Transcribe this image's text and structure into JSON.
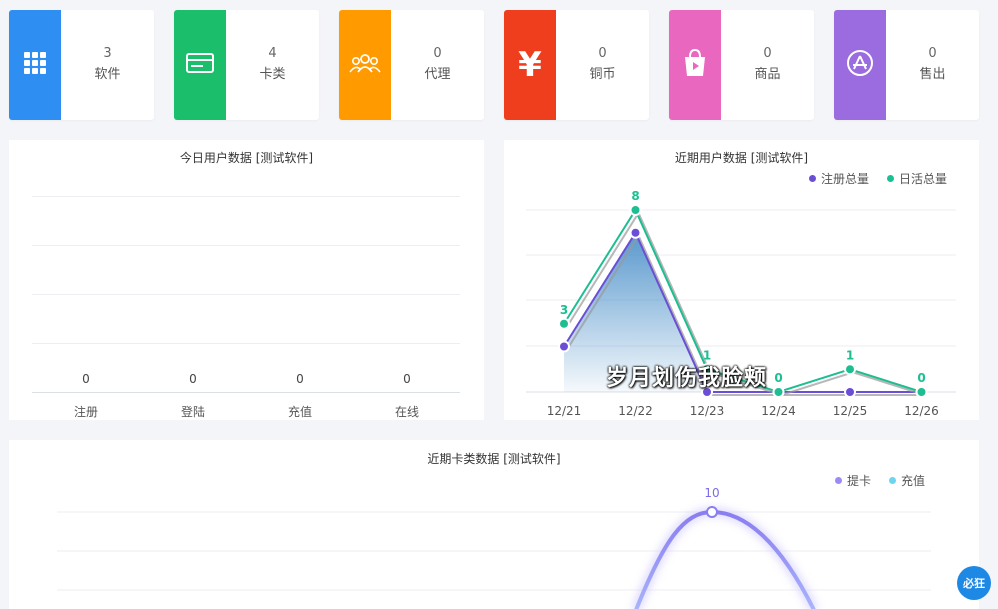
{
  "stats": [
    {
      "value": "3",
      "label": "软件",
      "color": "#2f8ef1",
      "icon": "grid-icon"
    },
    {
      "value": "4",
      "label": "卡类",
      "color": "#1bbf6b",
      "icon": "card-icon"
    },
    {
      "value": "0",
      "label": "代理",
      "color": "#ff9a00",
      "icon": "people-icon"
    },
    {
      "value": "0",
      "label": "铜币",
      "color": "#ee3e1d",
      "icon": "yen-icon"
    },
    {
      "value": "0",
      "label": "商品",
      "color": "#e967be",
      "icon": "shopping-bag-icon"
    },
    {
      "value": "0",
      "label": "售出",
      "color": "#9b6be0",
      "icon": "app-store-icon"
    }
  ],
  "today_chart": {
    "title": "今日用户数据 [测试软件]",
    "chart_data": {
      "type": "bar",
      "categories": [
        "注册",
        "登陆",
        "充值",
        "在线"
      ],
      "values": [
        0,
        0,
        0,
        0
      ],
      "value_labels": [
        "0",
        "0",
        "0",
        "0"
      ]
    }
  },
  "recent_user_chart": {
    "title": "近期用户数据 [测试软件]",
    "legend": [
      {
        "label": "注册总量",
        "color": "#6a4fd6"
      },
      {
        "label": "日活总量",
        "color": "#1dbe91"
      }
    ],
    "chart_data": {
      "type": "line",
      "categories": [
        "12/21",
        "12/22",
        "12/23",
        "12/24",
        "12/25",
        "12/26"
      ],
      "series": [
        {
          "name": "注册总量",
          "values": [
            2,
            7,
            0,
            0,
            0,
            0
          ]
        },
        {
          "name": "日活总量",
          "values": [
            3,
            8,
            1,
            0,
            1,
            0
          ]
        }
      ],
      "point_labels": [
        "3",
        "8",
        "1",
        "0",
        "1",
        "0"
      ],
      "ylim": [
        0,
        8
      ]
    }
  },
  "recent_card_chart": {
    "title": "近期卡类数据 [测试软件]",
    "legend": [
      {
        "label": "提卡",
        "color": "#9a8cf2"
      },
      {
        "label": "充值",
        "color": "#6fd4ee"
      }
    ],
    "chart_data": {
      "type": "line",
      "peak_label": "10",
      "peak_value": 10
    }
  },
  "watermark": "岁月划伤我脸颊",
  "corner_badge": "必狂"
}
